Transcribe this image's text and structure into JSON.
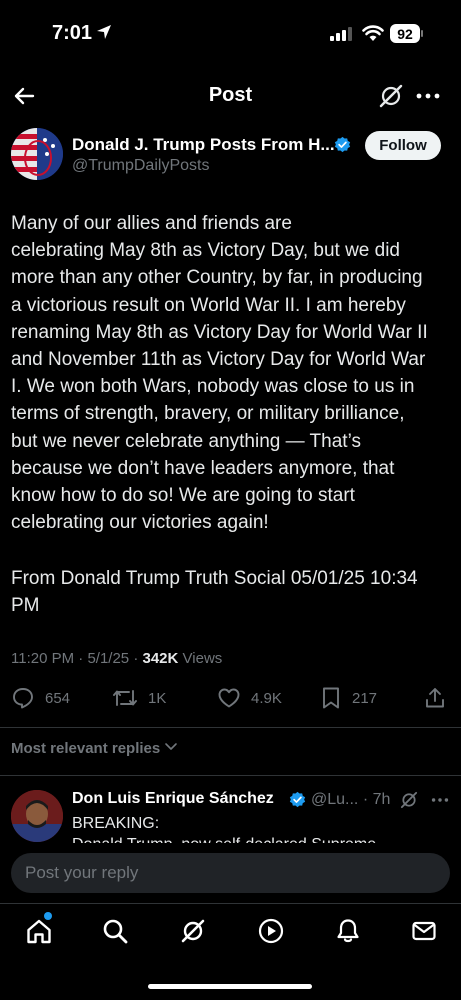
{
  "status_bar": {
    "time": "7:01",
    "battery": "92"
  },
  "nav": {
    "title": "Post"
  },
  "post": {
    "author_name": "Donald J. Trump Posts From H...",
    "author_handle": "@TrumpDailyPosts",
    "follow_label": "Follow",
    "body_lines": [
      "Many of our allies and friends are",
      "celebrating May 8th as Victory Day, but we did",
      "more than any other Country, by far, in producing",
      "a victorious result on World War II. I am hereby",
      "renaming May 8th as Victory Day for World War II",
      "and November 11th as Victory Day for World War",
      "I. We won both Wars, nobody was close to us in",
      "terms of strength, bravery, or military brilliance,",
      "but we never celebrate anything — That’s",
      "because we don’t have leaders  anymore, that",
      "know how to do so! We are going to start",
      "celebrating our victories again!"
    ],
    "source_lines": [
      "From Donald Trump Truth Social 05/01/25 10:34",
      "PM"
    ],
    "time": "11:20 PM",
    "date": "5/1/25",
    "separator": "·",
    "views_count": "342K",
    "views_label": "Views"
  },
  "actions": {
    "replies": "654",
    "reposts": "1K",
    "likes": "4.9K",
    "bookmarks": "217"
  },
  "replies_filter": {
    "label": "Most relevant replies"
  },
  "reply": {
    "name": "Don Luis Enrique Sánchez",
    "handle_time": "@Lu... · 7h",
    "line1": "BREAKING:",
    "line2": "Donald Trump, now self-declared Supreme"
  },
  "composer": {
    "placeholder": "Post your reply"
  },
  "tab_bar": {
    "items": [
      "home-icon",
      "search-icon",
      "grok-icon",
      "video-icon",
      "notifications-icon",
      "messages-icon"
    ]
  },
  "colors": {
    "accent": "#1d9bf0",
    "background": "#000000",
    "muted": "#71767b",
    "text": "#e7e9ea"
  }
}
